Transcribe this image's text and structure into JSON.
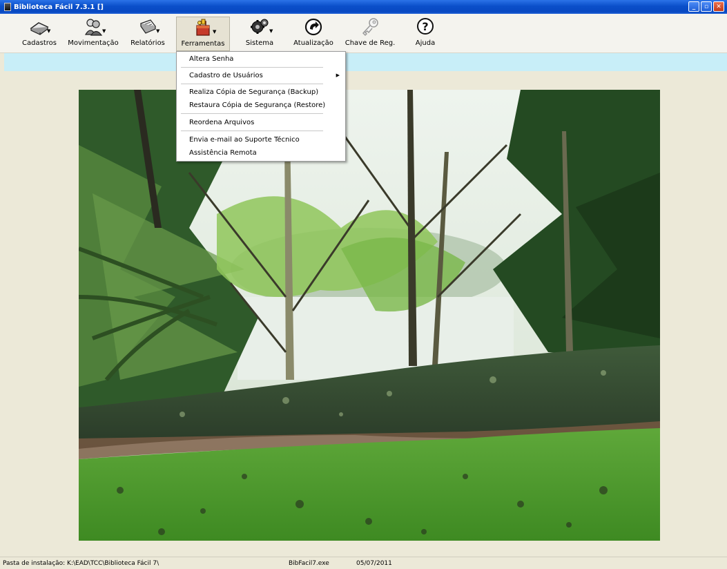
{
  "window": {
    "title": "Biblioteca Fácil 7.3.1 []"
  },
  "toolbar": [
    {
      "label": "Cadastros",
      "icon": "book-icon"
    },
    {
      "label": "Movimentação",
      "icon": "people-icon"
    },
    {
      "label": "Relatórios",
      "icon": "report-icon"
    },
    {
      "label": "Ferramentas",
      "icon": "toolbox-icon",
      "active": true
    },
    {
      "label": "Sistema",
      "icon": "gears-icon"
    },
    {
      "label": "Atualização",
      "icon": "refresh-icon"
    },
    {
      "label": "Chave de Reg.",
      "icon": "key-icon"
    },
    {
      "label": "Ajuda",
      "icon": "help-icon"
    }
  ],
  "menu": {
    "items": [
      {
        "label": "Altera Senha"
      },
      {
        "label": "Cadastro de Usuários",
        "submenu": true
      },
      {
        "label": "Realiza Cópia de Segurança (Backup)"
      },
      {
        "label": "Restaura Cópia de Segurança (Restore)"
      },
      {
        "label": "Reordena Arquivos"
      },
      {
        "label": "Envia e-mail ao Suporte Técnico"
      },
      {
        "label": "Assistência Remota"
      }
    ]
  },
  "status": {
    "path": "Pasta de instalação: K:\\EAD\\TCC\\Biblioteca Fácil 7\\",
    "exe": "BibFacil7.exe",
    "date": "05/07/2011"
  }
}
